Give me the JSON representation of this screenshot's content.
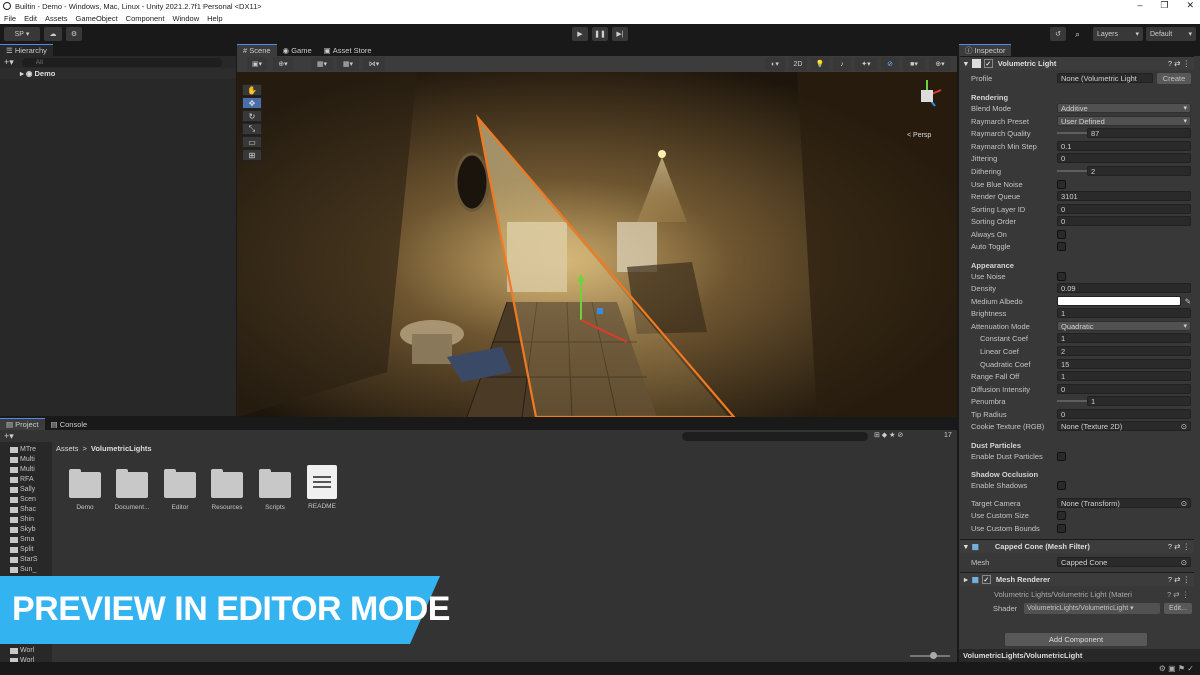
{
  "window": {
    "title": "Builtin - Demo - Windows, Mac, Linux - Unity 2021.2.7f1 Personal <DX11>"
  },
  "menu": [
    "File",
    "Edit",
    "Assets",
    "GameObject",
    "Component",
    "Window",
    "Help"
  ],
  "toolbar": {
    "account": "SP",
    "layers": "Layers",
    "layout": "Default"
  },
  "hierarchy": {
    "tab": "Hierarchy",
    "search_placeholder": "All",
    "root": "Demo"
  },
  "scene_tabs": [
    "Scene",
    "Game",
    "Asset Store"
  ],
  "scene": {
    "mode_2d": "2D",
    "persp": "< Persp"
  },
  "bottom_tabs": {
    "project": "Project",
    "console": "Console"
  },
  "project": {
    "breadcrumb": [
      "Assets",
      "VolumetricLights"
    ],
    "count": "17",
    "tree": [
      "MTre",
      "Multi",
      "Multi",
      "RFA",
      "Sally",
      "Scen",
      "Shac",
      "Shin",
      "Skyb",
      "Sma",
      "Split",
      "StarS",
      "Sun_",
      "Worl",
      "Worl"
    ],
    "folders": [
      "Demo",
      "Document...",
      "Editor",
      "Resources",
      "Scripts"
    ],
    "readme": "README"
  },
  "banner": {
    "text": "PREVIEW IN EDITOR MODE",
    "color": "#33b3f0"
  },
  "inspector": {
    "tab": "Inspector",
    "component": "Volumetric Light",
    "profile": {
      "label": "Profile",
      "value": "None (Volumetric Light",
      "create": "Create"
    },
    "rendering": "Rendering",
    "blend_mode": {
      "label": "Blend Mode",
      "value": "Additive"
    },
    "raymarch_preset": {
      "label": "Raymarch Preset",
      "value": "User Defined"
    },
    "raymarch_quality": {
      "label": "Raymarch Quality",
      "value": "87",
      "fraction": 0.35
    },
    "raymarch_min_step": {
      "label": "Raymarch Min Step",
      "value": "0.1"
    },
    "jittering": {
      "label": "Jittering",
      "value": "0"
    },
    "dithering": {
      "label": "Dithering",
      "value": "2",
      "fraction": 1.0
    },
    "use_blue_noise": "Use Blue Noise",
    "render_queue": {
      "label": "Render Queue",
      "value": "3101"
    },
    "sorting_layer": {
      "label": "Sorting Layer ID",
      "value": "0"
    },
    "sorting_order": {
      "label": "Sorting Order",
      "value": "0"
    },
    "always_on": "Always On",
    "auto_toggle": "Auto Toggle",
    "appearance": "Appearance",
    "use_noise": "Use Noise",
    "density": {
      "label": "Density",
      "value": "0.09"
    },
    "medium_albedo": "Medium Albedo",
    "brightness": {
      "label": "Brightness",
      "value": "1"
    },
    "attenuation_mode": {
      "label": "Attenuation Mode",
      "value": "Quadratic"
    },
    "constant_coef": {
      "label": "Constant Coef",
      "value": "1"
    },
    "linear_coef": {
      "label": "Linear Coef",
      "value": "2"
    },
    "quadratic_coef": {
      "label": "Quadratic Coef",
      "value": "15"
    },
    "range_falloff": {
      "label": "Range Fall Off",
      "value": "1"
    },
    "diffusion": {
      "label": "Diffusion Intensity",
      "value": "0"
    },
    "penumbra": {
      "label": "Penumbra",
      "value": "1",
      "fraction": 1.0
    },
    "tip_radius": {
      "label": "Tip Radius",
      "value": "0"
    },
    "cookie": {
      "label": "Cookie Texture (RGB)",
      "value": "None (Texture 2D)"
    },
    "dust": "Dust Particles",
    "enable_dust": "Enable Dust Particles",
    "shadow": "Shadow Occlusion",
    "enable_shadows": "Enable Shadows",
    "target_camera": {
      "label": "Target Camera",
      "value": "None (Transform)"
    },
    "custom_size": "Use Custom Size",
    "custom_bounds": "Use Custom Bounds",
    "mesh_filter": "Capped Cone (Mesh Filter)",
    "mesh": {
      "label": "Mesh",
      "value": "Capped Cone"
    },
    "mesh_renderer": "Mesh Renderer",
    "material": "Volumetric Lights/Volumetric Light (Materi",
    "shader": {
      "label": "Shader",
      "value": "VolumetricLights/VolumetricLight",
      "edit": "Edit..."
    },
    "add_component": "Add Component",
    "footer": "VolumetricLights/VolumetricLight"
  }
}
